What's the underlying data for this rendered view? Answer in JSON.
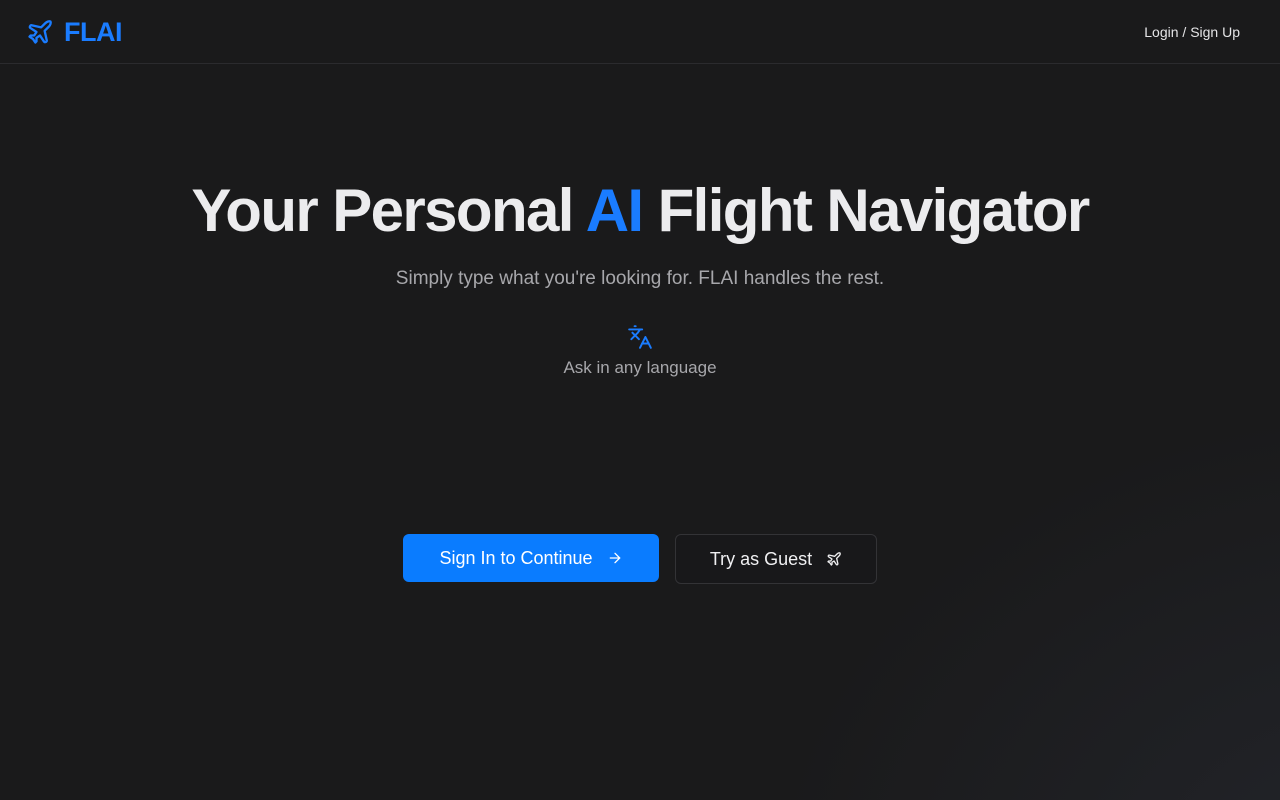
{
  "header": {
    "brand_name": "FLAI",
    "auth_link": "Login / Sign Up"
  },
  "hero": {
    "title_part1": "Your Personal ",
    "title_accent": "AI",
    "title_part2": " Flight Navigator",
    "subtitle": "Simply type what you're looking for. FLAI handles the rest.",
    "feature_icon": "translate-icon",
    "feature_label": "Ask in any language"
  },
  "actions": {
    "primary_label": "Sign In to Continue",
    "primary_icon": "arrow-right-icon",
    "secondary_label": "Try as Guest",
    "secondary_icon": "plane-icon"
  },
  "colors": {
    "accent": "#1a7cff",
    "background": "#1a1a1b",
    "text": "#ececee",
    "muted_text": "#a7a7ab"
  }
}
